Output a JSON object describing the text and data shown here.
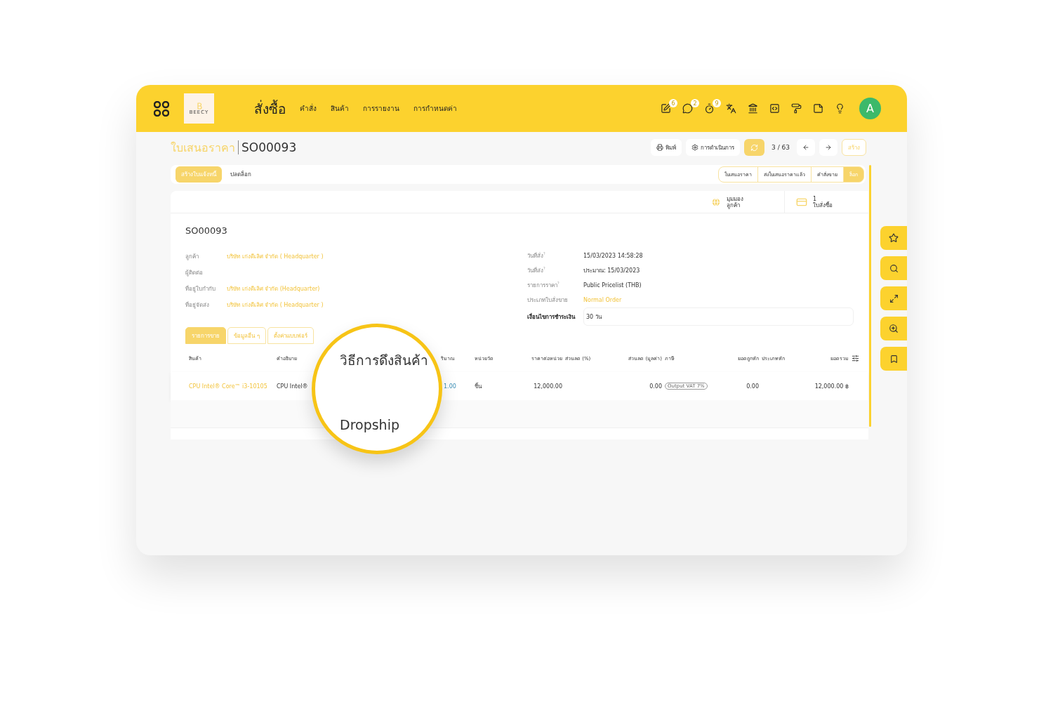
{
  "header": {
    "logo": "BEECY",
    "title": "สั่งซื้อ",
    "menu": [
      "คำสั่ง",
      "สินค้า",
      "การรายงาน",
      "การกำหนดค่า"
    ],
    "icons": [
      {
        "kind": "edit",
        "badge": "6"
      },
      {
        "kind": "chat",
        "badge": "2"
      },
      {
        "kind": "timer",
        "badge": "9"
      },
      {
        "kind": "translate"
      },
      {
        "kind": "building"
      },
      {
        "kind": "code"
      },
      {
        "kind": "roller"
      },
      {
        "kind": "note"
      },
      {
        "kind": "bulb"
      }
    ],
    "avatar": "A"
  },
  "breadcrumb": {
    "parent": "ใบเสนอราคา",
    "current": "SO00093"
  },
  "toolbar": {
    "print": "พิมพ์",
    "action": "การดำเนินการ",
    "pager": "3 / 63",
    "create": "สร้าง"
  },
  "actions": [
    {
      "label": "สร้างใบแจ้งหนี้",
      "kind": "primary"
    },
    {
      "label": "ปลดล็อก",
      "kind": "plain"
    }
  ],
  "statuses": [
    {
      "label": "ใบเสนอราคา",
      "selected": false
    },
    {
      "label": "ส่งใบเสนอราคาแล้ว",
      "selected": false
    },
    {
      "label": "คำสั่งขาย",
      "selected": false
    },
    {
      "label": "ล็อก",
      "selected": true
    }
  ],
  "stat_buttons": [
    {
      "kind": "globe",
      "lines": [
        "มุมมอง",
        "ลูกค้า"
      ]
    },
    {
      "kind": "card",
      "lines": [
        "1",
        "ใบสั่งซื้อ"
      ]
    }
  ],
  "form": {
    "title": "SO00093",
    "left_fields": [
      {
        "label": "ลูกค้า",
        "value": "บริษัท เก่งดีเลิศ จำกัด ( Headquarter )",
        "kind": "link"
      },
      {
        "label": "ผู้ติดต่อ",
        "kind": "empty"
      },
      {
        "label": "ที่อยู่ใบกำกับ",
        "value": "บริษัท เก่งดีเลิศ จำกัด (Headquarter)",
        "kind": "link"
      },
      {
        "label": "ที่อยู่จัดส่ง",
        "value": "บริษัท เก่งดีเลิศ จำกัด ( Headquarter )",
        "kind": "link"
      }
    ],
    "right_fields": [
      {
        "label": "วันที่สั่ง",
        "help": "?",
        "value": "15/03/2023 14:58:28",
        "kind": "text"
      },
      {
        "label": "วันที่ส่ง",
        "help": "?",
        "value": "ประมาณ:  15/03/2023",
        "kind": "text"
      },
      {
        "label": "รายการราคา",
        "help": "?",
        "value": "Public Pricelist (THB)",
        "kind": "text"
      },
      {
        "label": "ประเภทใบสั่งขาย",
        "value": "Normal Order",
        "kind": "link"
      },
      {
        "label": "เงื่อนไขการชำระเงิน",
        "value": "30 วัน",
        "kind": "input"
      }
    ]
  },
  "notebook_tabs": [
    {
      "label": "รายการขาย",
      "selected": true
    },
    {
      "label": "ข้อมูลอื่น ๆ",
      "selected": false
    },
    {
      "label": "ตั้งค่าแบบฟอร์",
      "selected": false
    }
  ],
  "table": {
    "columns": [
      "สินค้า",
      "คำอธิบาย",
      "ริมาณ",
      "หน่วยวัด",
      "ราคาต่อหน่วย",
      "ส่วนลด (%)",
      "ส่วนลด (มูลค่า)",
      "ภาษี",
      "ยอดถูกหัก",
      "ประเภทหัก",
      "ยอดรวม"
    ],
    "rows": [
      {
        "cells": [
          {
            "text": "CPU Intel® Core™ i3-10105",
            "kind": "link"
          },
          {
            "text": "CPU Intel®",
            "kind": "text"
          },
          {
            "text": "1.00",
            "kind": "number"
          },
          {
            "text": "ชิ้น",
            "kind": "text"
          },
          {
            "text": "12,000.00",
            "kind": "text"
          },
          {
            "kind": "empty"
          },
          {
            "text": "0.00",
            "kind": "text"
          },
          {
            "text": "Output VAT 7%",
            "kind": "tag"
          },
          {
            "text": "0.00",
            "kind": "text"
          },
          {
            "kind": "empty"
          },
          {
            "text": "12,000.00 ฿",
            "kind": "text"
          }
        ]
      }
    ]
  },
  "magnifier": {
    "title": "วิธีการดึงสินค้า",
    "value": "Dropship"
  }
}
